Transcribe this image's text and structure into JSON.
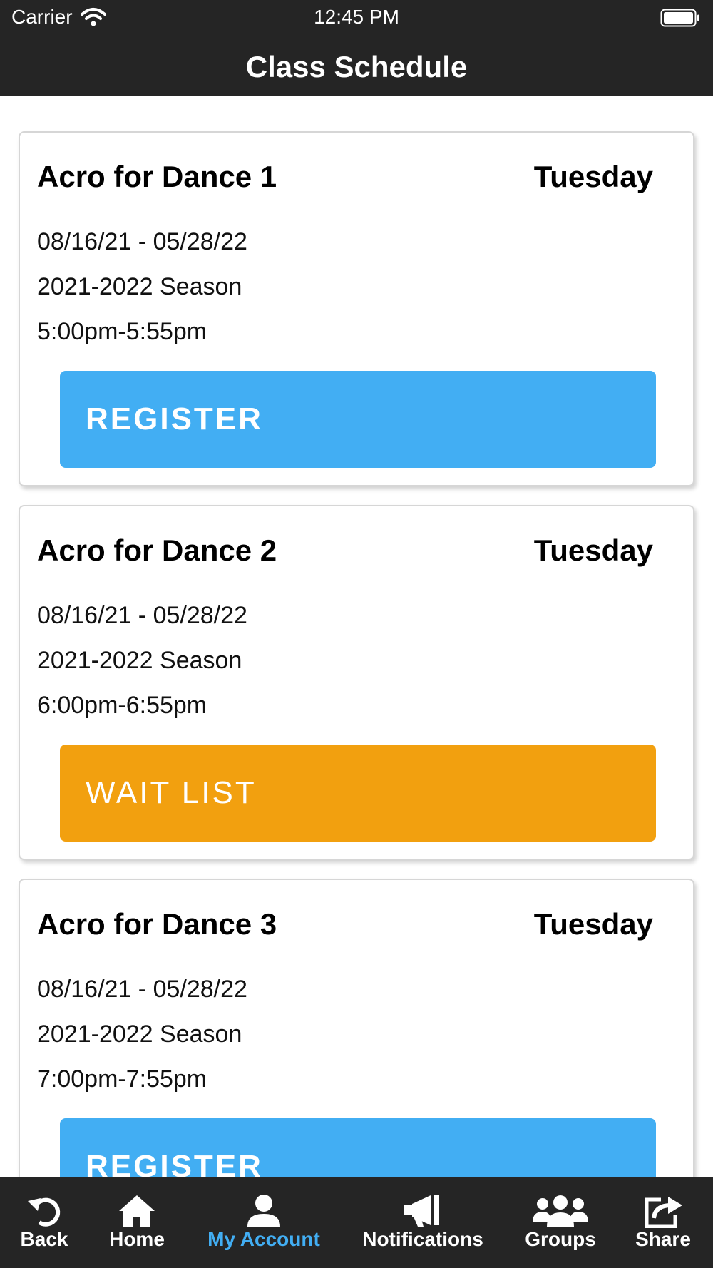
{
  "status_bar": {
    "carrier": "Carrier",
    "time": "12:45 PM",
    "wifi_icon": "wifi-icon",
    "battery_icon": "battery-icon"
  },
  "header": {
    "title": "Class Schedule"
  },
  "classes": [
    {
      "name": "Acro for Dance 1",
      "day": "Tuesday",
      "dates": "08/16/21 - 05/28/22",
      "season": "2021-2022 Season",
      "time": "5:00pm-5:55pm",
      "action": "REGISTER",
      "action_color": "#42aef3"
    },
    {
      "name": "Acro for Dance 2",
      "day": "Tuesday",
      "dates": "08/16/21 - 05/28/22",
      "season": "2021-2022 Season",
      "time": "6:00pm-6:55pm",
      "action": "WAIT LIST",
      "action_color": "#f2a00f"
    },
    {
      "name": "Acro for Dance 3",
      "day": "Tuesday",
      "dates": "08/16/21 - 05/28/22",
      "season": "2021-2022 Season",
      "time": "7:00pm-7:55pm",
      "action": "REGISTER",
      "action_color": "#42aef3"
    }
  ],
  "tab_bar": {
    "active_color": "#42aef3",
    "items": [
      {
        "label": "Back",
        "icon": "back-arrow-icon"
      },
      {
        "label": "Home",
        "icon": "home-icon"
      },
      {
        "label": "My Account",
        "icon": "user-icon",
        "active": true
      },
      {
        "label": "Notifications",
        "icon": "megaphone-icon"
      },
      {
        "label": "Groups",
        "icon": "groups-icon"
      },
      {
        "label": "Share",
        "icon": "share-icon"
      }
    ]
  }
}
